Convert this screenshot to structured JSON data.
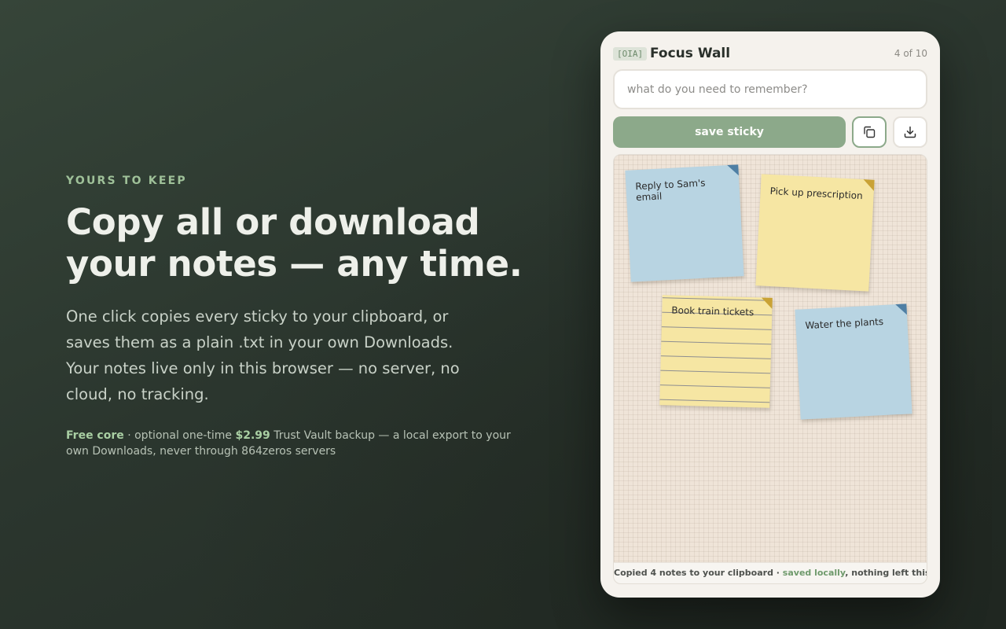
{
  "hero": {
    "eyebrow": "YOURS TO KEEP",
    "headline": "Copy all or download your notes — any time.",
    "lede": "One click copies every sticky to your clipboard, or saves them as a plain .txt in your own Downloads. Your notes live only in this browser — no server, no cloud, no tracking.",
    "fine": {
      "free_label": "Free core",
      "text_a": " · optional one-time ",
      "price": "$2.99",
      "text_b": " Trust Vault backup — a local export to your own Downloads, never through 864zeros servers"
    }
  },
  "app": {
    "badge": "[OIA]",
    "title": "Focus Wall",
    "count": "4 of 10",
    "input_placeholder": "what do you need to remember?",
    "input_value": "",
    "save_label": "save sticky",
    "copy_icon": "copy-icon",
    "download_icon": "download-icon",
    "stickies": [
      {
        "text": "Reply to Sam's email",
        "color": "blue"
      },
      {
        "text": "Pick up prescription",
        "color": "yellow"
      },
      {
        "text": "Book train tickets",
        "color": "yellow-lined"
      },
      {
        "text": "Water the plants",
        "color": "blue"
      }
    ],
    "status": {
      "prefix": "Copied 4 notes to your clipboard · ",
      "ok": "saved locally",
      "suffix": ", nothing left this browser"
    }
  },
  "colors": {
    "accent": "#8ca98a",
    "sticky_blue": "#b8d4e2",
    "sticky_yellow": "#f6e6a3",
    "eyebrow": "#9fc199"
  }
}
